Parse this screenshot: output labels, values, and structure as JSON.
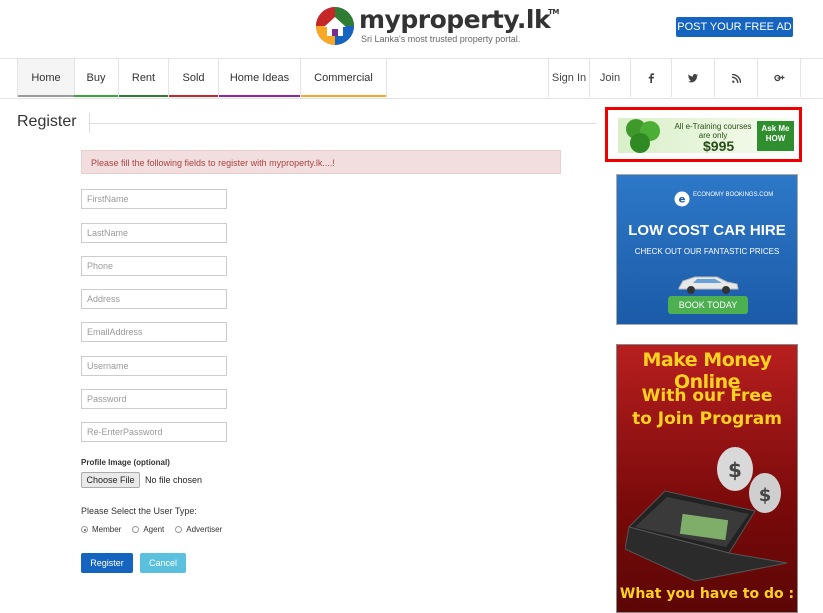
{
  "site": {
    "name": "myproperty.lk",
    "tm": "TM",
    "tagline": "Sri Lanka's most trusted property portal.",
    "post_ad": "POST YOUR FREE AD"
  },
  "nav": {
    "items": [
      {
        "label": "Home",
        "color": "#9c9c9c"
      },
      {
        "label": "Buy",
        "color": "#3aa63a"
      },
      {
        "label": "Rent",
        "color": "#2e7d32"
      },
      {
        "label": "Sold",
        "color": "#c62828"
      },
      {
        "label": "Home Ideas",
        "color": "#8e24aa"
      },
      {
        "label": "Commercial",
        "color": "#f9a825"
      }
    ],
    "sign_in": "Sign In",
    "join": "Join",
    "social": [
      "facebook-icon",
      "twitter-icon",
      "rss-icon",
      "google-plus-icon"
    ]
  },
  "page": {
    "title": "Register",
    "alert": "Please fill the following fields to register with myproperty.lk....!"
  },
  "form": {
    "fields": [
      {
        "placeholder": "FirstName"
      },
      {
        "placeholder": "LastName"
      },
      {
        "placeholder": "Phone"
      },
      {
        "placeholder": "Address"
      },
      {
        "placeholder": "EmailAddress"
      },
      {
        "placeholder": "Username"
      },
      {
        "placeholder": "Password"
      },
      {
        "placeholder": "Re-EnterPassword"
      }
    ],
    "profile_label": "Profile Image (optional)",
    "choose_file": "Choose File",
    "no_file": "No file chosen",
    "user_type_label": "Please Select the User Type:",
    "user_types": [
      "Member",
      "Agent",
      "Advertiser"
    ],
    "selected_user_type": "Member",
    "register": "Register",
    "cancel": "Cancel"
  },
  "ads": {
    "ad1": {
      "line1": "All e-Training courses are only",
      "price": "$995",
      "button": "Ask Me HOW"
    },
    "ad2": {
      "logo": "ECONOMY BOOKINGS.COM",
      "headline": "LOW COST CAR HIRE",
      "sub": "CHECK OUT OUR FANTASTIC PRICES",
      "button": "BOOK TODAY"
    },
    "ad3": {
      "headline": "Make Money Online",
      "sub": "With our Free to Join Program",
      "footer": "What you have to do :"
    }
  }
}
